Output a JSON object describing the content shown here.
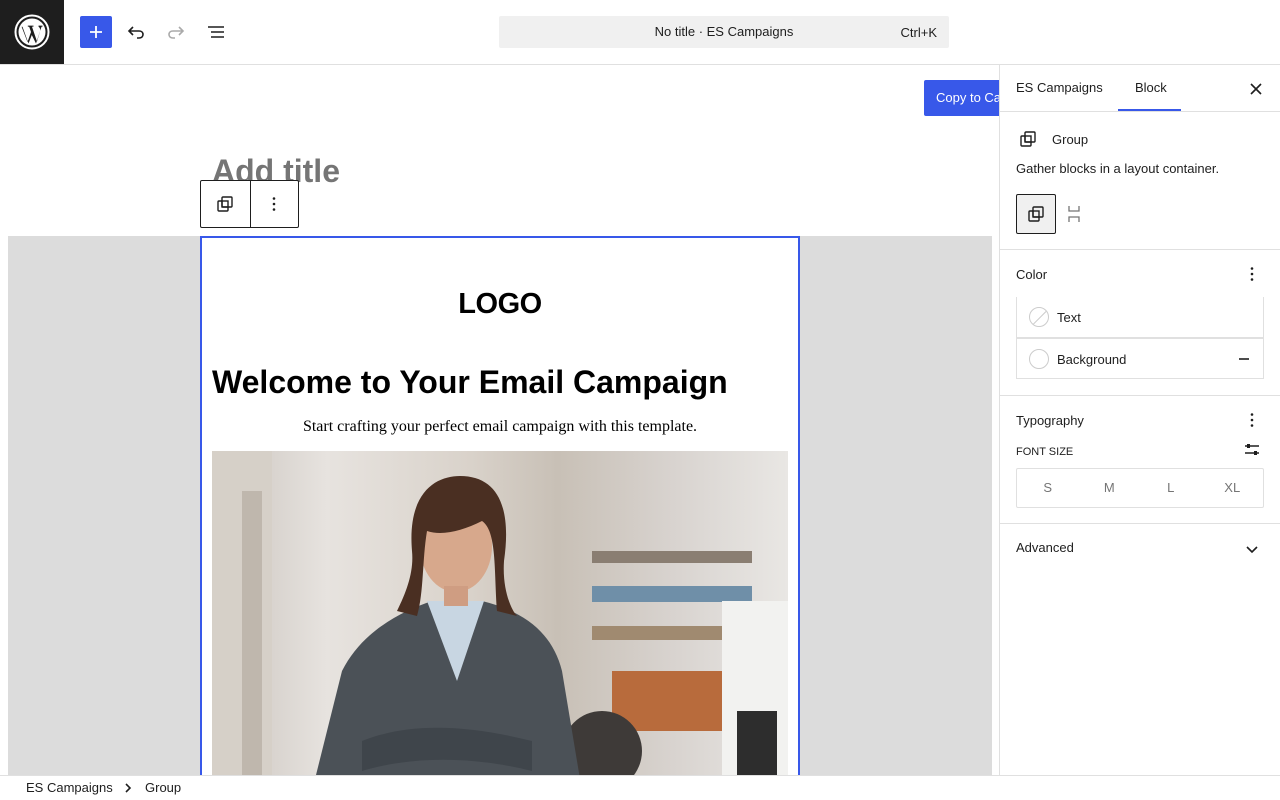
{
  "header": {
    "document_title": "No title · ES Campaigns",
    "shortcut": "Ctrl+K"
  },
  "canvas": {
    "copy_button": "Copy to Ca",
    "title_placeholder": "Add title",
    "email": {
      "logo": "LOGO",
      "headline": "Welcome to Your Email Campaign",
      "subline": "Start crafting your perfect email campaign with this template."
    }
  },
  "sidebar": {
    "tabs": [
      "ES Campaigns",
      "Block"
    ],
    "active_tab": "Block",
    "block": {
      "name": "Group",
      "description": "Gather blocks in a layout container."
    },
    "color": {
      "title": "Color",
      "items": [
        "Text",
        "Background"
      ]
    },
    "typography": {
      "title": "Typography",
      "font_size_label": "FONT SIZE",
      "sizes": [
        "S",
        "M",
        "L",
        "XL"
      ]
    },
    "advanced": {
      "title": "Advanced"
    }
  },
  "breadcrumb": [
    "ES Campaigns",
    "Group"
  ],
  "colors": {
    "accent": "#3858e9",
    "dark": "#1e1e1e",
    "canvas_gray": "#dcdcdc"
  }
}
